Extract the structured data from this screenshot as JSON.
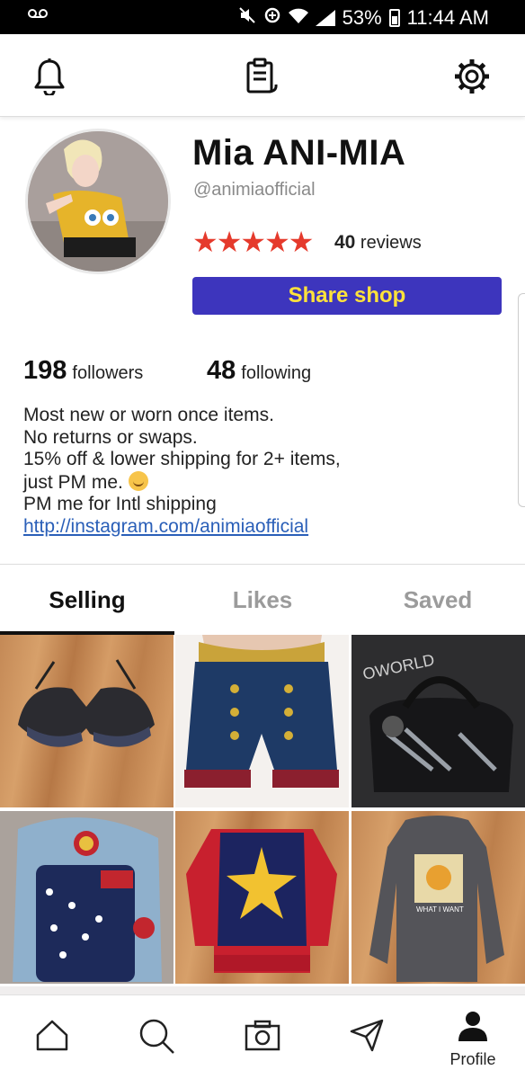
{
  "status_bar": {
    "battery": "53%",
    "time": "11:44 AM",
    "icons": [
      "voicemail-icon",
      "mute-icon",
      "data-saver-icon",
      "wifi-icon",
      "signal-icon",
      "battery-icon"
    ]
  },
  "top_nav": {
    "icons": [
      "bell-icon",
      "clipboard-icon",
      "settings-icon"
    ]
  },
  "profile": {
    "name": "Mia ANI-MIA",
    "handle": "@animiaofficial",
    "stars": "★★★★★",
    "rating": 5,
    "review_count": "40",
    "reviews_label": "reviews",
    "share_label": "Share shop",
    "followers_count": "198",
    "followers_label": "followers",
    "following_count": "48",
    "following_label": "following"
  },
  "bio": {
    "line1": "Most new or worn once items.",
    "line2": "No returns or swaps.",
    "line3": "15% off & lower shipping for 2+ items,",
    "line4": "just PM me.",
    "line5": "PM me for Intl shipping",
    "link": "http://instagram.com/animiaofficial"
  },
  "tabs": [
    {
      "label": "Selling",
      "active": true
    },
    {
      "label": "Likes",
      "active": false
    },
    {
      "label": "Saved",
      "active": false
    }
  ],
  "listings": [
    {
      "item": "black lace bra"
    },
    {
      "item": "navy sailor shorts with gold waistband"
    },
    {
      "item": "black panther handbag"
    },
    {
      "item": "wonder woman backpack"
    },
    {
      "item": "captain marvel sweater"
    },
    {
      "item": "gray graphic hoodie"
    }
  ],
  "bottom_nav": {
    "profile_label": "Profile",
    "icons": [
      "home-icon",
      "search-icon",
      "camera-icon",
      "send-icon",
      "profile-icon"
    ]
  },
  "colors": {
    "accent_button": "#3d35bd",
    "button_text": "#ffe23b",
    "stars": "#e53a2c",
    "link": "#2a5fb8"
  }
}
